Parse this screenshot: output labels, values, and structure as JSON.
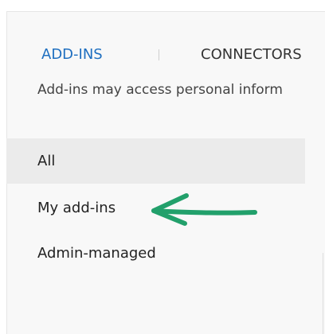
{
  "tabs": [
    {
      "label": "ADD-INS",
      "active": true
    },
    {
      "label": "CONNECTORS",
      "active": false
    }
  ],
  "notice_text": "Add-ins may access personal inform",
  "filters": [
    {
      "label": "All",
      "selected": true
    },
    {
      "label": "My add-ins",
      "selected": false
    },
    {
      "label": "Admin-managed",
      "selected": false
    }
  ],
  "colors": {
    "active_tab": "#1f6fc0",
    "annotation_arrow": "#22a06b",
    "selected_row": "#ebebeb",
    "panel_background": "#f8f8f8"
  },
  "annotation": {
    "icon": "arrow-left-icon",
    "points_to": "My add-ins"
  }
}
